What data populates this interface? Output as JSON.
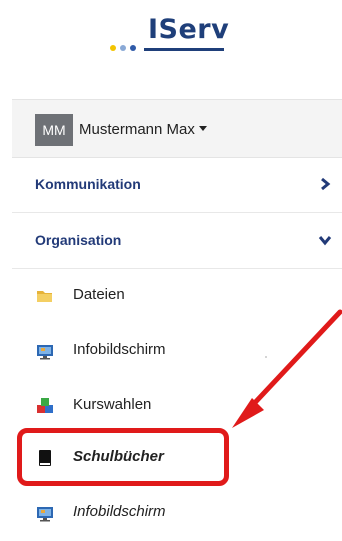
{
  "logo": {
    "text": "IServ",
    "dot_colors": [
      "#f3c400",
      "#8aa9d6",
      "#2f5aa8"
    ]
  },
  "user": {
    "initials": "MM",
    "name": "Mustermann Max"
  },
  "sections": [
    {
      "label": "Kommunikation",
      "icon": "chevron-right-icon",
      "expanded": false
    },
    {
      "label": "Organisation",
      "icon": "chevron-down-icon",
      "expanded": true
    }
  ],
  "items": [
    {
      "label": "Dateien",
      "icon": "folder-icon"
    },
    {
      "label": "Infobildschirm",
      "icon": "monitor-icon"
    },
    {
      "label": "Kurswahlen",
      "icon": "blocks-icon"
    },
    {
      "label": "Schulbücher",
      "icon": "book-icon",
      "highlighted": true
    },
    {
      "label": "Infobildschirm",
      "icon": "monitor-icon"
    }
  ],
  "colors": {
    "accent": "#223a78",
    "highlight": "#e01a1a"
  }
}
